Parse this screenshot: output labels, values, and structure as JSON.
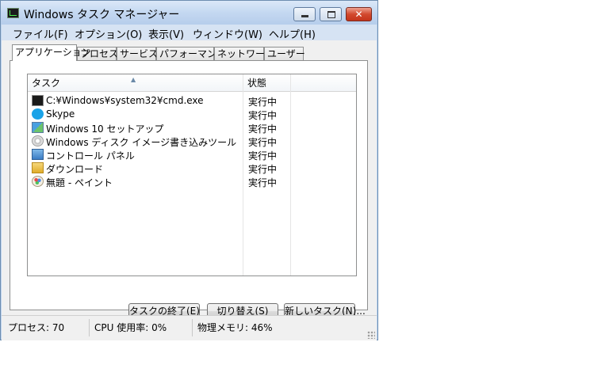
{
  "window": {
    "title": "Windows タスク マネージャー",
    "close_glyph": "✕"
  },
  "menu": [
    {
      "label": "ファイル(F)"
    },
    {
      "label": "オプション(O)"
    },
    {
      "label": "表示(V)"
    },
    {
      "label": "ウィンドウ(W)"
    },
    {
      "label": "ヘルプ(H)"
    }
  ],
  "tabs": [
    {
      "label": "アプリケーション",
      "active": true
    },
    {
      "label": "プロセス"
    },
    {
      "label": "サービス"
    },
    {
      "label": "パフォーマンス"
    },
    {
      "label": "ネットワーク"
    },
    {
      "label": "ユーザー"
    }
  ],
  "list": {
    "columns": [
      "タスク",
      "状態"
    ],
    "rows": [
      {
        "name": "C:¥Windows¥system32¥cmd.exe",
        "status": "実行中",
        "icon": "cmd-icon"
      },
      {
        "name": "Skype",
        "status": "実行中",
        "icon": "skype-icon"
      },
      {
        "name": "Windows 10 セットアップ",
        "status": "実行中",
        "icon": "setup-icon"
      },
      {
        "name": "Windows ディスク イメージ書き込みツール",
        "status": "実行中",
        "icon": "disc-icon"
      },
      {
        "name": "コントロール パネル",
        "status": "実行中",
        "icon": "control-panel-icon"
      },
      {
        "name": "ダウンロード",
        "status": "実行中",
        "icon": "folder-download-icon"
      },
      {
        "name": "無題 - ペイント",
        "status": "実行中",
        "icon": "paint-icon"
      }
    ]
  },
  "buttons": {
    "end_task": "タスクの終了(E)",
    "switch_to": "切り替え(S)",
    "new_task": "新しいタスク(N)..."
  },
  "status_bar": {
    "processes": "プロセス: 70",
    "cpu": "CPU 使用率: 0%",
    "memory": "物理メモリ: 46%"
  },
  "colors": {
    "titlebar": "#c4d8f1",
    "close_button": "#c4341b",
    "panel": "#f0f0f0"
  }
}
